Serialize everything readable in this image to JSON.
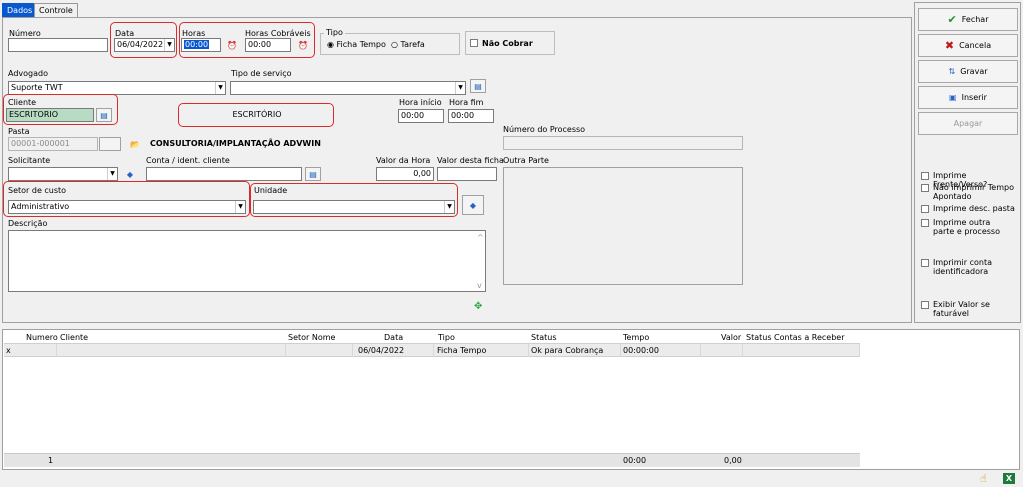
{
  "tabs": [
    "Dados",
    "Controle"
  ],
  "form": {
    "numero_label": "Número",
    "numero_value": "",
    "data_label": "Data",
    "data_value": "06/04/2022",
    "horas_label": "Horas",
    "horas_value": "00:00",
    "horas_cobraveis_label": "Horas Cobráveis",
    "horas_cobraveis_value": "00:00",
    "tipo_label": "Tipo",
    "tipo_opt1": "Ficha Tempo",
    "tipo_opt2": "Tarefa",
    "nao_cobrar": "Não Cobrar",
    "advogado_label": "Advogado",
    "advogado_value": "Suporte TWT",
    "tipo_servico_label": "Tipo de serviço",
    "tipo_servico_value": "",
    "cliente_label": "Cliente",
    "cliente_value": "ESCRITORIO",
    "cliente_desc": "ESCRITÓRIO",
    "hora_inicio_label": "Hora início",
    "hora_inicio_value": "00:00",
    "hora_fim_label": "Hora fim",
    "hora_fim_value": "00:00",
    "pasta_label": "Pasta",
    "pasta_value": "00001-000001",
    "pasta_desc": "CONSULTORIA/IMPLANTAÇÃO ADVWIN",
    "num_processo_label": "Número do Processo",
    "num_processo_value": "",
    "solicitante_label": "Solicitante",
    "solicitante_value": "",
    "conta_label": "Conta / ident. cliente",
    "conta_value": "",
    "valor_hora_label": "Valor da Hora",
    "valor_hora_value": "0,00",
    "valor_ficha_label": "Valor desta ficha",
    "valor_ficha_value": "",
    "outra_parte_label": "Outra Parte",
    "outra_parte_value": "",
    "setor_label": "Setor de custo",
    "setor_value": "Administrativo",
    "unidade_label": "Unidade",
    "unidade_value": "",
    "descricao_label": "Descrição",
    "descricao_value": ""
  },
  "buttons": {
    "fechar": "Fechar",
    "cancelar": "Cancela",
    "gravar": "Gravar",
    "inserir": "Inserir",
    "apagar": "Apagar"
  },
  "options": {
    "frente_verso": "Imprime Frente/Verso?",
    "nao_imprimir": "Não imprimir Tempo Apontado",
    "desc_pasta": "Imprime desc. pasta",
    "outra_parte": "Imprime outra parte e processo",
    "conta_ident": "Imprimir conta identificadora",
    "exibir_valor": "Exibir Valor se faturável"
  },
  "grid": {
    "columns": {
      "numero": "Numero",
      "cliente": "Cliente",
      "setor": "Setor Nome",
      "data": "Data",
      "tipo": "Tipo",
      "status": "Status",
      "tempo": "Tempo",
      "valor": "Valor",
      "status_contas": "Status Contas a Receber"
    },
    "row": {
      "marker": "x",
      "numero": "",
      "cliente": "",
      "setor": "",
      "data": "06/04/2022",
      "tipo": "Ficha Tempo",
      "status": "Ok para Cobrança",
      "tempo": "00:00:00",
      "valor": "",
      "status_contas": ""
    },
    "footer": {
      "count": "1",
      "tempo": "00:00",
      "valor": "0,00"
    }
  },
  "colors": {
    "accent": "#0a58d0",
    "highlight": "#d92b2b",
    "green": "#b7dcc3"
  }
}
